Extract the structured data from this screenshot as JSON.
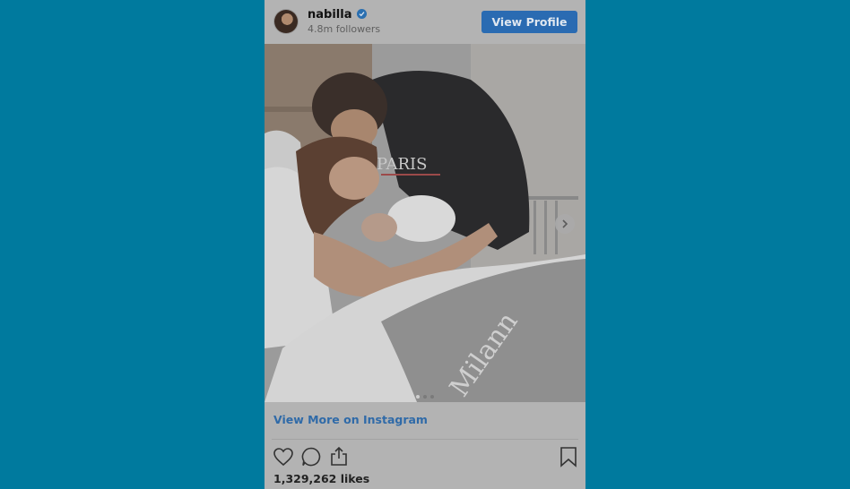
{
  "post": {
    "username": "nabilla",
    "followers": "4.8m followers",
    "view_profile_label": "View Profile",
    "view_more_label": "View More on Instagram",
    "likes": "1,329,262 likes",
    "carousel": {
      "count": 3,
      "active_index": 1
    },
    "image_text": {
      "blanket_name": "Milann",
      "shirt_text": "PARIS"
    }
  },
  "colors": {
    "background": "#007a9e",
    "card": "#b3b3b3",
    "accent": "#2a6bb2"
  },
  "icons": [
    "avatar",
    "verified-badge-icon",
    "chevron-right-icon",
    "heart-icon",
    "comment-icon",
    "share-icon",
    "bookmark-icon"
  ]
}
